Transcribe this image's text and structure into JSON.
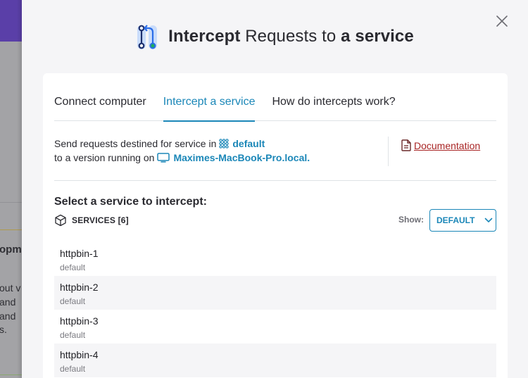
{
  "background": {
    "texts": [
      "opm",
      "out v",
      " and",
      " and",
      "s."
    ]
  },
  "dialog": {
    "title": {
      "part1": "Intercept",
      "part2": " Requests to ",
      "part3": "a service"
    },
    "close_icon": "close-icon",
    "tabs": [
      {
        "label": "Connect computer",
        "active": false
      },
      {
        "label": "Intercept a service",
        "active": true
      },
      {
        "label": "How do intercepts work?",
        "active": false
      }
    ],
    "info": {
      "line1_prefix": "Send requests destined for service in",
      "namespace": "default",
      "line2_prefix": "to a version running on",
      "machine": "Maximes-MacBook-Pro.local.",
      "documentation_label": "Documentation"
    },
    "section_title": "Select a service to intercept:",
    "services_label": "SERVICES [6]",
    "show_label": "Show:",
    "show_selected": "DEFAULT",
    "services": [
      {
        "name": "httpbin-1",
        "namespace": "default"
      },
      {
        "name": "httpbin-2",
        "namespace": "default"
      },
      {
        "name": "httpbin-3",
        "namespace": "default"
      },
      {
        "name": "httpbin-4",
        "namespace": "default"
      }
    ]
  },
  "colors": {
    "accent": "#1b87b8",
    "doc_link": "#a82424",
    "header_purple": "#5a3fa8"
  }
}
